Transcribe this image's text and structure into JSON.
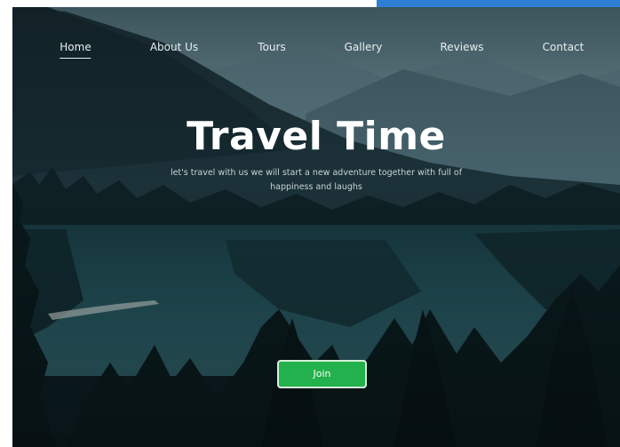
{
  "nav": {
    "items": [
      {
        "label": "Home",
        "active": true
      },
      {
        "label": "About Us",
        "active": false
      },
      {
        "label": "Tours",
        "active": false
      },
      {
        "label": "Gallery",
        "active": false
      },
      {
        "label": "Reviews",
        "active": false
      },
      {
        "label": "Contact",
        "active": false
      }
    ]
  },
  "hero": {
    "title": "Travel Time",
    "subtitle": "let's travel with us we will start a new adventure together with full of happiness and laughs",
    "join_label": "Join"
  },
  "colors": {
    "accent_bar": "#2f7fd6",
    "join_button": "#22b14c",
    "sky": "#5e7e88",
    "water": "#1f4a52"
  }
}
